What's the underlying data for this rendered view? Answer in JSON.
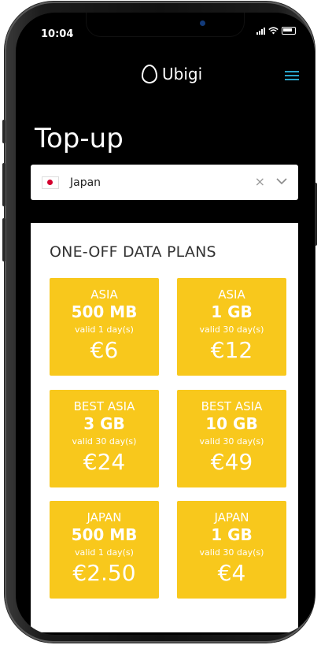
{
  "status_bar": {
    "time": "10:04"
  },
  "brand": {
    "name": "Ubigi"
  },
  "page": {
    "title": "Top-up"
  },
  "country_select": {
    "value": "Japan",
    "clear_symbol": "×"
  },
  "plans": {
    "heading": "ONE-OFF DATA PLANS",
    "items": [
      {
        "region": "ASIA",
        "size": "500 MB",
        "validity": "valid 1 day(s)",
        "price": "€6"
      },
      {
        "region": "ASIA",
        "size": "1 GB",
        "validity": "valid 30 day(s)",
        "price": "€12"
      },
      {
        "region": "BEST ASIA",
        "size": "3 GB",
        "validity": "valid 30 day(s)",
        "price": "€24"
      },
      {
        "region": "BEST ASIA",
        "size": "10 GB",
        "validity": "valid 30 day(s)",
        "price": "€49"
      },
      {
        "region": "JAPAN",
        "size": "500 MB",
        "validity": "valid 1 day(s)",
        "price": "€2.50"
      },
      {
        "region": "JAPAN",
        "size": "1 GB",
        "validity": "valid 30 day(s)",
        "price": "€4"
      }
    ]
  },
  "colors": {
    "accent": "#2aa4c9",
    "card": "#f8c81c",
    "background": "#000000"
  }
}
